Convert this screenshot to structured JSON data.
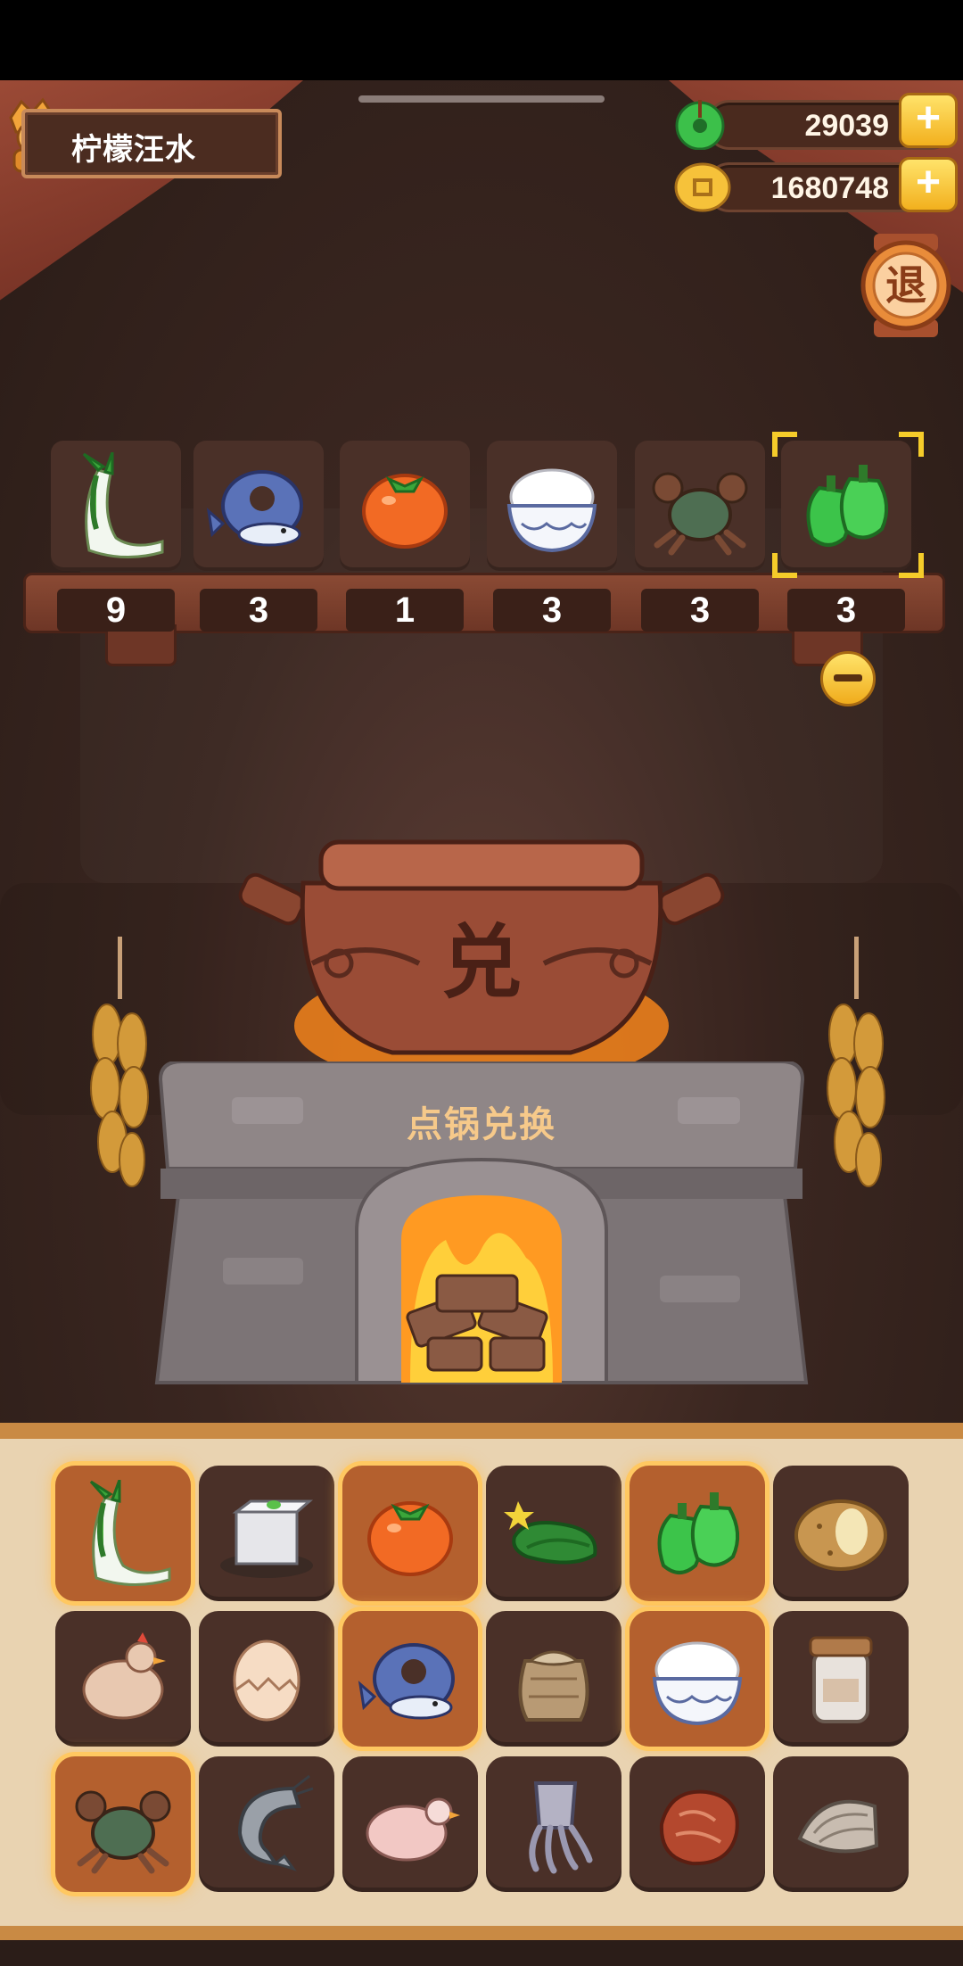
{
  "player": {
    "name": "柠檬汪水"
  },
  "currency": {
    "jade": {
      "value": "29039",
      "icon": "jade-icon"
    },
    "coins": {
      "value": "1680748",
      "icon": "coin-icon"
    }
  },
  "exit_button": {
    "label": "退"
  },
  "selected_ingredients": [
    {
      "icon": "leek-icon",
      "count": "9"
    },
    {
      "icon": "fish-icon",
      "count": "3"
    },
    {
      "icon": "tomato-icon",
      "count": "1"
    },
    {
      "icon": "rice-bowl-icon",
      "count": "3"
    },
    {
      "icon": "crab-icon",
      "count": "3"
    },
    {
      "icon": "green-pepper-icon",
      "count": "3"
    }
  ],
  "pot": {
    "symbol": "兑"
  },
  "stove": {
    "label": "点锅兑换"
  },
  "inventory": [
    {
      "icon": "leek-icon",
      "selected": true
    },
    {
      "icon": "tofu-icon",
      "selected": false
    },
    {
      "icon": "tomato-icon",
      "selected": true
    },
    {
      "icon": "cucumber-icon",
      "selected": false
    },
    {
      "icon": "green-pepper-icon",
      "selected": true
    },
    {
      "icon": "potato-icon",
      "selected": false
    },
    {
      "icon": "chicken-icon",
      "selected": false
    },
    {
      "icon": "egg-icon",
      "selected": false
    },
    {
      "icon": "fish-icon",
      "selected": true
    },
    {
      "icon": "flour-sack-icon",
      "selected": false
    },
    {
      "icon": "rice-bowl-icon",
      "selected": true
    },
    {
      "icon": "jar-icon",
      "selected": false
    },
    {
      "icon": "crab-icon",
      "selected": true
    },
    {
      "icon": "shrimp-icon",
      "selected": false
    },
    {
      "icon": "duck-icon",
      "selected": false
    },
    {
      "icon": "squid-icon",
      "selected": false
    },
    {
      "icon": "meat-icon",
      "selected": false
    },
    {
      "icon": "clam-icon",
      "selected": false
    }
  ]
}
